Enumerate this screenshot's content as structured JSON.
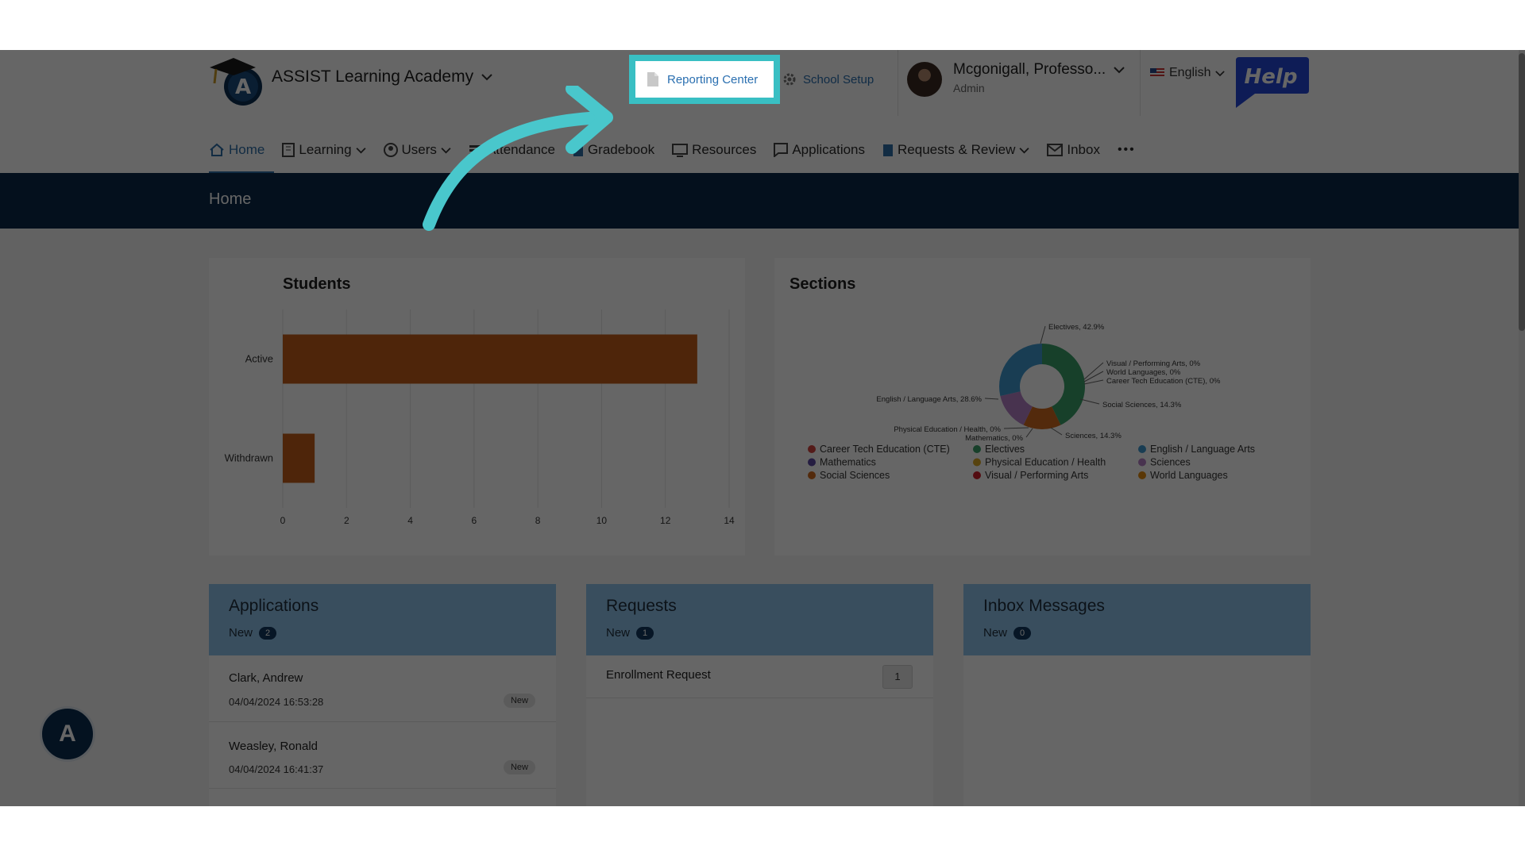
{
  "header": {
    "school_name": "ASSIST Learning Academy",
    "reporting_center": "Reporting Center",
    "school_setup": "School Setup",
    "user_name": "Mcgonigall, Professo...",
    "user_role": "Admin",
    "language": "English",
    "help": "Help"
  },
  "nav": {
    "items": [
      "Home",
      "Learning",
      "Users",
      "Attendance",
      "Gradebook",
      "Resources",
      "Applications",
      "Requests & Review",
      "Inbox"
    ],
    "more": "•••"
  },
  "banner": {
    "title": "Home"
  },
  "students": {
    "title": "Students",
    "chart_data": {
      "type": "bar",
      "orientation": "horizontal",
      "categories": [
        "Active",
        "Withdrawn"
      ],
      "values": [
        13,
        1
      ],
      "xlim": [
        0,
        14
      ],
      "xticks": [
        "0",
        "2",
        "4",
        "6",
        "8",
        "10",
        "12",
        "14"
      ],
      "color": "#c25e1b",
      "grid": true
    }
  },
  "sections": {
    "title": "Sections",
    "chart_data": {
      "type": "pie",
      "donut": true,
      "slices": [
        {
          "name": "Electives",
          "value": 42.9,
          "label": "Electives, 42.9%",
          "color": "#3aa06a"
        },
        {
          "name": "Visual / Performing Arts",
          "value": 0,
          "label": "Visual / Performing Arts, 0%",
          "color": "#d0202b"
        },
        {
          "name": "World Languages",
          "value": 0,
          "label": "World Languages, 0%",
          "color": "#e0890f"
        },
        {
          "name": "Career Tech Education (CTE)",
          "value": 0,
          "label": "Career Tech Education (CTE), 0%",
          "color": "#d2453f"
        },
        {
          "name": "Social Sciences",
          "value": 14.3,
          "label": "Social Sciences, 14.3%",
          "color": "#d06a1e"
        },
        {
          "name": "Sciences",
          "value": 14.3,
          "label": "Sciences, 14.3%",
          "color": "#b47fc5"
        },
        {
          "name": "Mathematics",
          "value": 0,
          "label": "Mathematics, 0%",
          "color": "#5d4aa2"
        },
        {
          "name": "Physical Education / Health",
          "value": 0,
          "label": "Physical Education / Health, 0%",
          "color": "#d9a826"
        },
        {
          "name": "English / Language Arts",
          "value": 28.6,
          "label": "English / Language Arts, 28.6%",
          "color": "#3f9ad0"
        }
      ],
      "legend": [
        [
          "Career Tech Education (CTE)",
          "Electives",
          "English / Language Arts"
        ],
        [
          "Mathematics",
          "Physical Education / Health",
          "Sciences"
        ],
        [
          "Social Sciences",
          "Visual / Performing Arts",
          "World Languages"
        ]
      ],
      "legend_position": "bottom"
    }
  },
  "applications": {
    "title": "Applications",
    "new_label": "New",
    "new_count": "2",
    "rows": [
      {
        "name": "Clark, Andrew",
        "date": "04/04/2024 16:53:28",
        "tag": "New"
      },
      {
        "name": "Weasley, Ronald",
        "date": "04/04/2024 16:41:37",
        "tag": "New"
      }
    ]
  },
  "requests": {
    "title": "Requests",
    "new_label": "New",
    "new_count": "1",
    "rows": [
      {
        "name": "Enrollment Request",
        "count": "1"
      }
    ]
  },
  "inbox": {
    "title": "Inbox Messages",
    "new_label": "New",
    "new_count": "0"
  }
}
